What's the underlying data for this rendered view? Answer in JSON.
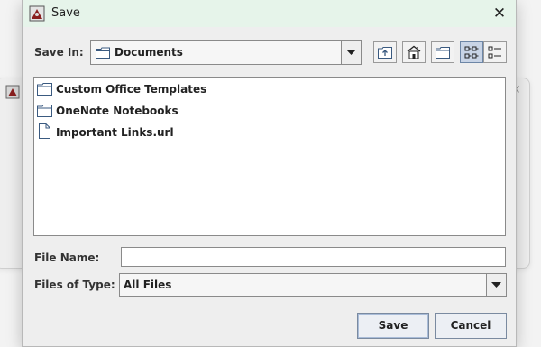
{
  "dialog": {
    "title": "Save",
    "title_icon": "java-app-icon",
    "close_icon": "close-icon",
    "close_glyph": "✕"
  },
  "background_window": {
    "close_glyph": "✕"
  },
  "save_in": {
    "label": "Save In:",
    "value": "Documents",
    "icon": "folder-icon"
  },
  "toolbar": [
    {
      "name": "up-one-level-button",
      "icon": "up-folder-icon"
    },
    {
      "name": "home-button",
      "icon": "home-icon"
    },
    {
      "name": "new-folder-button",
      "icon": "new-folder-icon"
    },
    {
      "name": "list-view-button",
      "icon": "list-view-icon",
      "selected": true
    },
    {
      "name": "details-view-button",
      "icon": "details-view-icon",
      "selected": false
    }
  ],
  "files": [
    {
      "name": "Custom Office Templates",
      "type": "folder"
    },
    {
      "name": "OneNote Notebooks",
      "type": "folder"
    },
    {
      "name": "Important Links.url",
      "type": "file"
    }
  ],
  "file_name": {
    "label": "File Name:",
    "value": ""
  },
  "files_of_type": {
    "label": "Files of Type:",
    "value": "All Files"
  },
  "buttons": {
    "save": "Save",
    "cancel": "Cancel"
  }
}
